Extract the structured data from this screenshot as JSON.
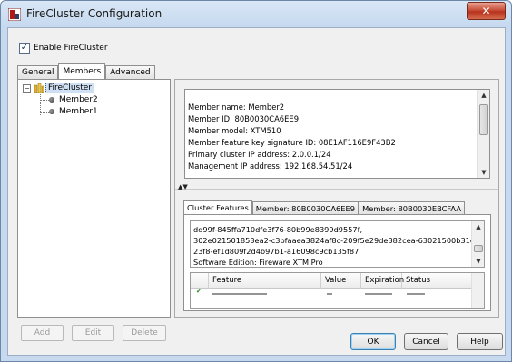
{
  "window": {
    "title": "FireCluster Configuration",
    "close_symbol": "✕"
  },
  "enable": {
    "label": "Enable FireCluster",
    "checked": true
  },
  "tabs": [
    "General",
    "Members",
    "Advanced"
  ],
  "active_tab": "Members",
  "tree": {
    "root_label": "FireCluster",
    "expander": "−",
    "members": [
      "Member2",
      "Member1"
    ]
  },
  "left_buttons": {
    "add": "Add",
    "edit": "Edit",
    "delete": "Delete"
  },
  "member_info": [
    "Member name: Member2",
    "Member ID: 80B0030CA6EE9",
    "Member model: XTM510",
    "Member feature key signature ID: 08E1AF116E9F43B2",
    "Primary cluster IP address: 2.0.0.1/24",
    "Management IP address: 192.168.54.51/24"
  ],
  "inner_tabs": [
    "Cluster Features",
    "Member: 80B0030CA6EE9",
    "Member: 80B0030EBCFAA"
  ],
  "active_inner_tab": "Cluster Features",
  "feature_key_lines": [
    "dd99f-845ffa710dfe3f76-80b99e8399d9557f,",
    "302e021501853ea2-c3bfaaea3824af8c-209f5e29de382cea-63021500b31c",
    "23f8-ef1d809f2d4b97b1-a16098c9cb135f87",
    "Software Edition: Fireware XTM Pro"
  ],
  "feature_table": {
    "columns": [
      "Feature",
      "Value",
      "Expiration",
      "Status"
    ]
  },
  "dialog_buttons": {
    "ok": "OK",
    "cancel": "Cancel",
    "help": "Help"
  },
  "colors": {
    "title_bar": "#c6d9ef",
    "close_button": "#c8503a",
    "selection": "#cfe0f4",
    "window_bg": "#f0f0f0"
  }
}
